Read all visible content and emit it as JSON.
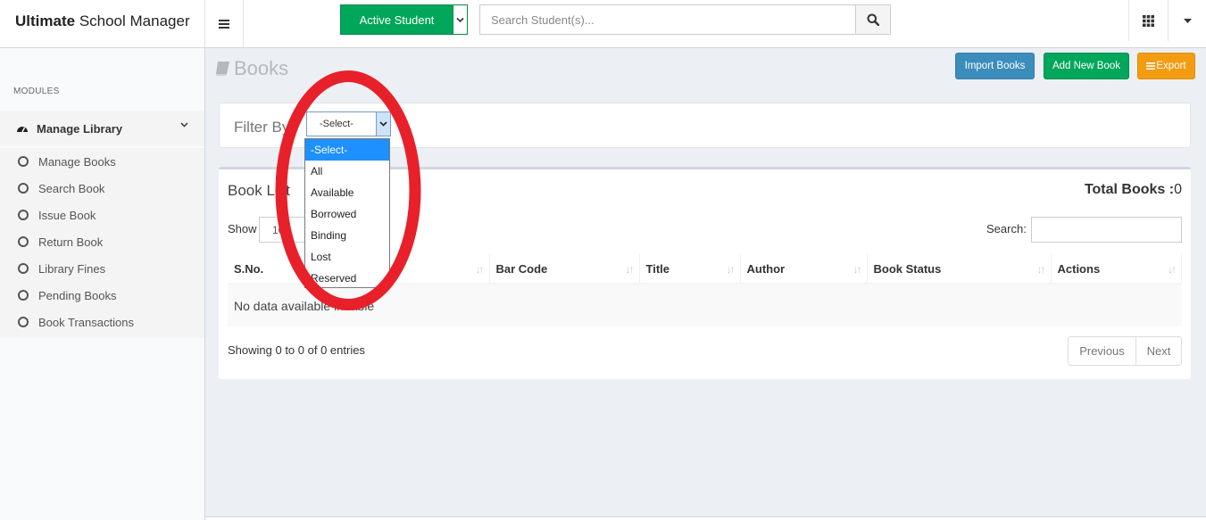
{
  "brand": {
    "bold": "Ultimate",
    "rest": "School Manager"
  },
  "header": {
    "active_student": "Active Student",
    "search_placeholder": "Search Student(s)..."
  },
  "sidebar": {
    "modules_label": "MODULES",
    "section": "Manage Library",
    "items": [
      "Manage Books",
      "Search Book",
      "Issue Book",
      "Return Book",
      "Library Fines",
      "Pending Books",
      "Book Transactions"
    ]
  },
  "page": {
    "title": "Books",
    "buttons": {
      "import": "Import Books",
      "add": "Add New Book",
      "export": "Export"
    }
  },
  "filter": {
    "label": "Filter By",
    "selected": "-Select-",
    "options": [
      "-Select-",
      "All",
      "Available",
      "Borrowed",
      "Binding",
      "Lost",
      "Reserved"
    ]
  },
  "book_list": {
    "title": "Book List",
    "total_label": "Total Books :",
    "total_value": "0",
    "show_label": "Show",
    "show_value": "10",
    "search_label": "Search:",
    "columns": [
      "S.No.",
      "",
      "Bar Code",
      "Title",
      "Author",
      "Book Status",
      "Actions"
    ],
    "empty_message": "No data available in table",
    "showing": "Showing 0 to 0 of 0 entries",
    "pager": {
      "previous": "Previous",
      "next": "Next"
    }
  },
  "colors": {
    "green": "#00a65a",
    "blue": "#3c8dbc",
    "orange": "#f39c12",
    "annotation_red": "#e8202a"
  }
}
